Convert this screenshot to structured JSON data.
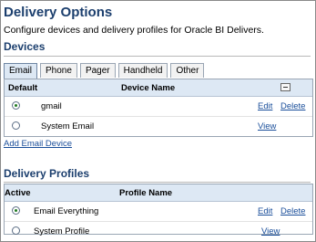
{
  "page": {
    "title": "Delivery Options",
    "description": "Configure devices and delivery profiles for Oracle BI Delivers."
  },
  "devices": {
    "heading": "Devices",
    "tabs": [
      {
        "label": "Email",
        "active": true
      },
      {
        "label": "Phone",
        "active": false
      },
      {
        "label": "Pager",
        "active": false
      },
      {
        "label": "Handheld",
        "active": false
      },
      {
        "label": "Other",
        "active": false
      }
    ],
    "columns": {
      "default": "Default",
      "name": "Device Name"
    },
    "rows": [
      {
        "name": "gmail",
        "selected": true,
        "actions": [
          "Edit",
          "Delete"
        ]
      },
      {
        "name": "System Email",
        "selected": false,
        "actions": [
          "View"
        ]
      }
    ],
    "add_link": "Add Email Device"
  },
  "profiles": {
    "heading": "Delivery Profiles",
    "columns": {
      "active": "Active",
      "name": "Profile Name"
    },
    "rows": [
      {
        "name": "Email Everything",
        "selected": true,
        "actions": [
          "Edit",
          "Delete"
        ]
      },
      {
        "name": "System Profile",
        "selected": false,
        "actions": [
          "View"
        ]
      }
    ]
  },
  "colors": {
    "heading": "#1c3f6e",
    "link": "#1a4e9a",
    "header_bg": "#dde8f4",
    "radio_dot": "#1f7a1f"
  }
}
